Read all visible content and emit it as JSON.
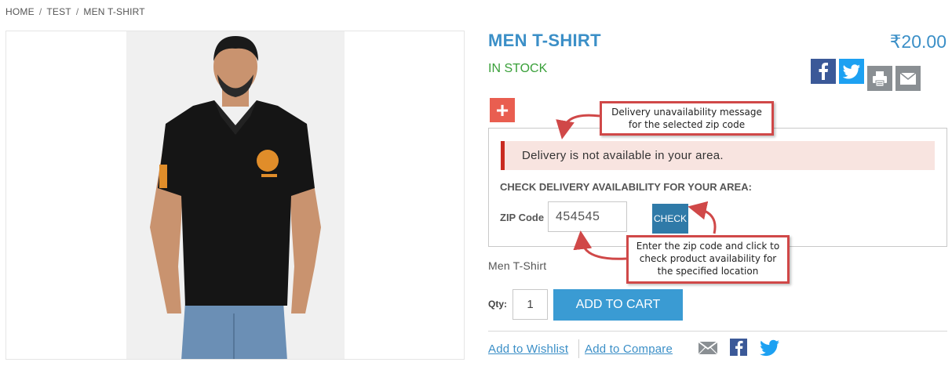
{
  "breadcrumb": [
    "HOME",
    "TEST",
    "MEN T-SHIRT"
  ],
  "breadcrumb_sep": "/",
  "product": {
    "title": "MEN T-SHIRT",
    "price": "₹20.00",
    "stock": "IN STOCK",
    "name": "Men T-Shirt"
  },
  "share_icons": [
    "facebook-icon",
    "twitter-icon",
    "print-icon",
    "email-icon"
  ],
  "plus_symbol": "+",
  "delivery": {
    "alert": "Delivery is not available in your area.",
    "heading": "CHECK DELIVERY AVAILABILITY FOR YOUR AREA:",
    "zip_label": "ZIP Code",
    "zip_value": "454545",
    "check_label": "CHECK"
  },
  "callouts": {
    "top": [
      "Delivery unavailability message",
      "for the selected zip code"
    ],
    "bottom": [
      "Enter the zip code and click to",
      "check product availability for",
      "the specified location"
    ]
  },
  "cart": {
    "qty_label": "Qty:",
    "qty_value": "1",
    "add_label": "ADD TO CART"
  },
  "links": {
    "wishlist": "Add to Wishlist",
    "compare": "Add to Compare"
  },
  "colors": {
    "accent": "#3b8fc7",
    "stock": "#3aa03a",
    "alert_border": "#c92a20",
    "alert_bg": "#f8e4e0",
    "callout_border": "#d04848",
    "facebook": "#3b5998",
    "twitter": "#1da1f2",
    "cart_button": "#3a9bd3"
  }
}
